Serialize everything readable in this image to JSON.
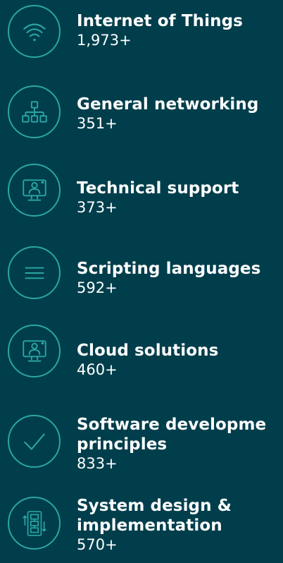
{
  "items": [
    {
      "icon": "wifi-icon",
      "title": "Internet of Things",
      "count": "1,973+"
    },
    {
      "icon": "network-icon",
      "title": "General networking",
      "count": "351+"
    },
    {
      "icon": "support-icon",
      "title": "Technical support",
      "count": "373+"
    },
    {
      "icon": "menu-icon",
      "title": "Scripting languages",
      "count": "592+"
    },
    {
      "icon": "cloud-support-icon",
      "title": "Cloud solutions",
      "count": "460+"
    },
    {
      "icon": "check-icon",
      "title_line1": "Software developme",
      "title_line2": "principles",
      "count": "833+"
    },
    {
      "icon": "system-design-icon",
      "title_line1": "System design &",
      "title_line2": "implementation",
      "count": "570+"
    }
  ],
  "colors": {
    "background": "#003e4c",
    "accent": "#2aa6a3",
    "text": "#ffffff"
  }
}
